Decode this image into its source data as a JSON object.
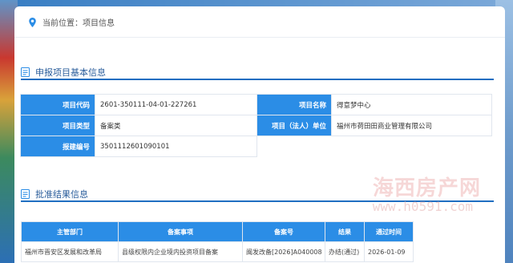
{
  "breadcrumb": {
    "prefix": "当前位置：",
    "current": "项目信息"
  },
  "section_basic": {
    "title": "申报项目基本信息"
  },
  "basic_info": {
    "rows": [
      [
        {
          "label": "项目代码",
          "value": "2601-350111-04-01-227261"
        },
        {
          "label": "项目名称",
          "value": "得意梦中心"
        }
      ],
      [
        {
          "label": "项目类型",
          "value": "备案类"
        },
        {
          "label": "项目（法人）单位",
          "value": "福州市荷田田商业管理有限公司"
        }
      ],
      [
        {
          "label": "报建编号",
          "value": "3501112601090101"
        }
      ]
    ]
  },
  "section_result": {
    "title": "批准结果信息"
  },
  "result_table": {
    "headers": [
      "主管部门",
      "备案事项",
      "备案号",
      "结果",
      "通过时间"
    ],
    "rows": [
      [
        "福州市晋安区发展和改革局",
        "县级权限内企业境内投资项目备案",
        "闽发改备[2026]A040008",
        "办结(通过)",
        "2026-01-09"
      ]
    ]
  },
  "watermark": {
    "line1": "海西房产网",
    "line2": "www.h0591.com"
  },
  "colors": {
    "accent": "#2b8de6",
    "title": "#2a5d9b"
  }
}
